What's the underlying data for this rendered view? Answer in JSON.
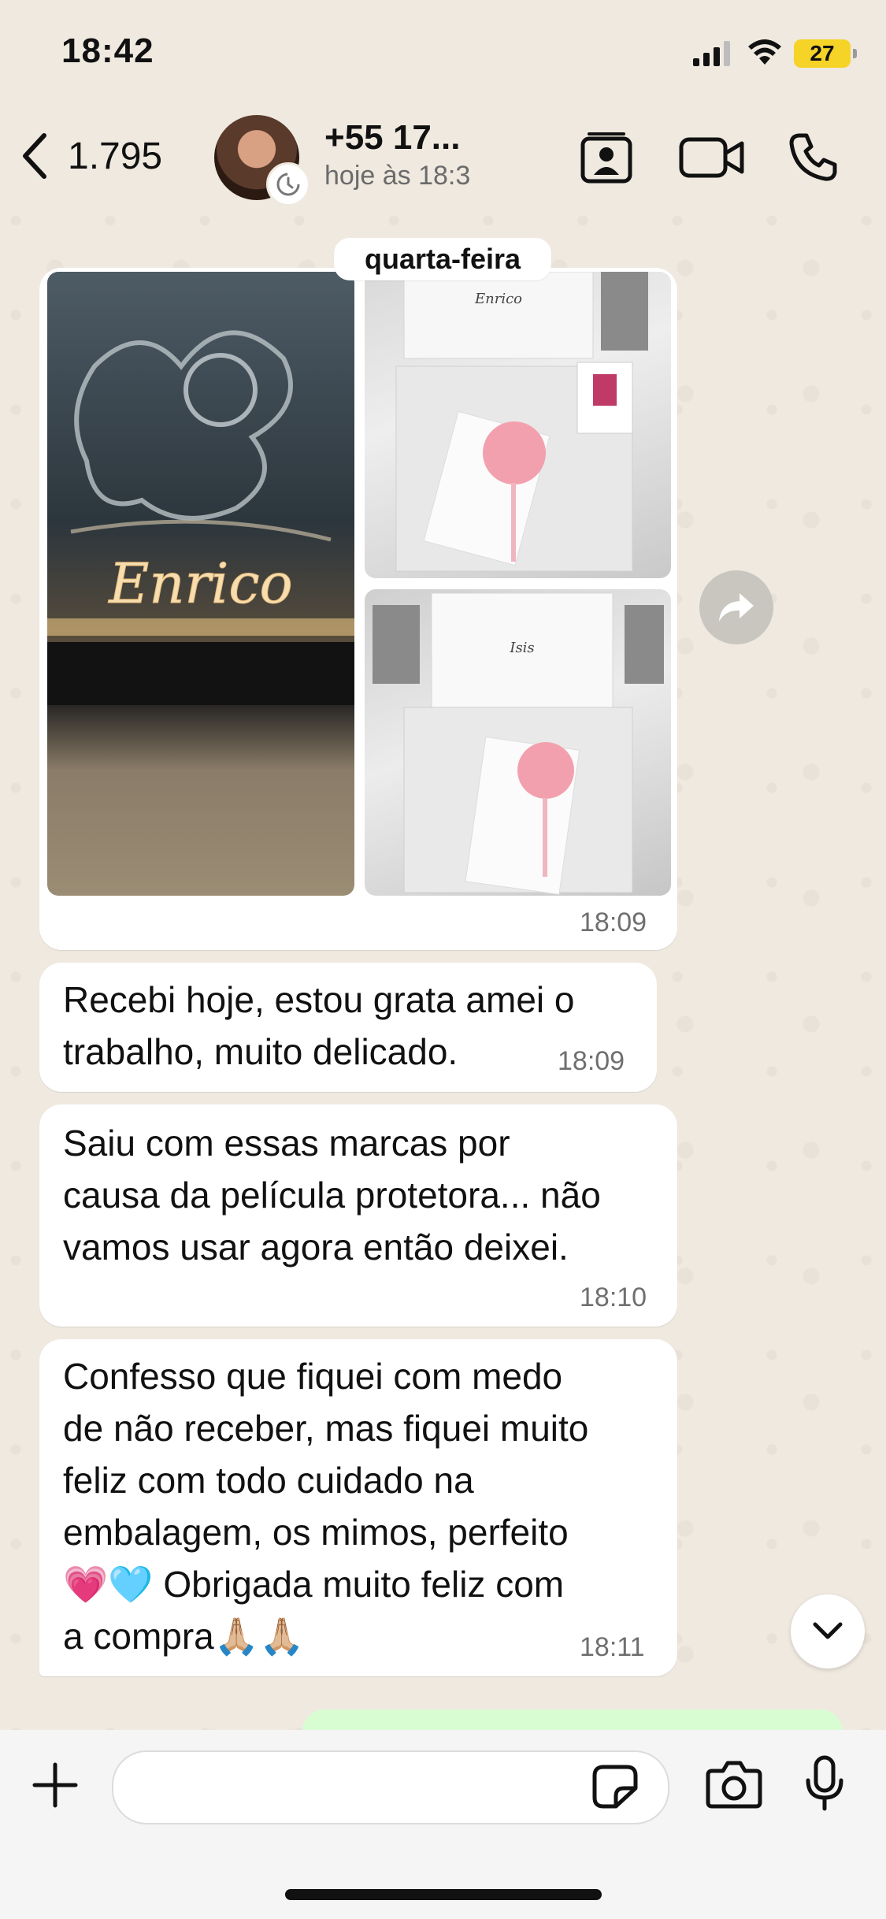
{
  "status_bar": {
    "time": "18:42",
    "battery": "27"
  },
  "header": {
    "back_count": "1.795",
    "contact_name": "+55 17...",
    "contact_status": "hoje às 18:3"
  },
  "chat": {
    "date_label": "quarta-feira",
    "media_time": "18:09",
    "photo_labels": {
      "photo1": "Enrico",
      "photo2": "Enrico",
      "photo3": "Isis"
    },
    "messages": [
      {
        "lines": [
          "Recebi hoje, estou grata amei o",
          "trabalho, muito delicado."
        ],
        "time": "18:09"
      },
      {
        "lines": [
          "Saiu com essas marcas por",
          "causa da película protetora... não",
          "vamos usar agora então deixei."
        ],
        "time": "18:10"
      },
      {
        "lines": [
          "Confesso que fiquei com medo",
          "de não receber, mas fiquei muito",
          "feliz com todo cuidado na",
          "embalagem, os mimos, perfeito",
          "💗🩵 Obrigada muito feliz com",
          "a compra🙏🏼🙏🏼"
        ],
        "time": "18:11"
      }
    ]
  },
  "composer": {
    "placeholder": ""
  }
}
